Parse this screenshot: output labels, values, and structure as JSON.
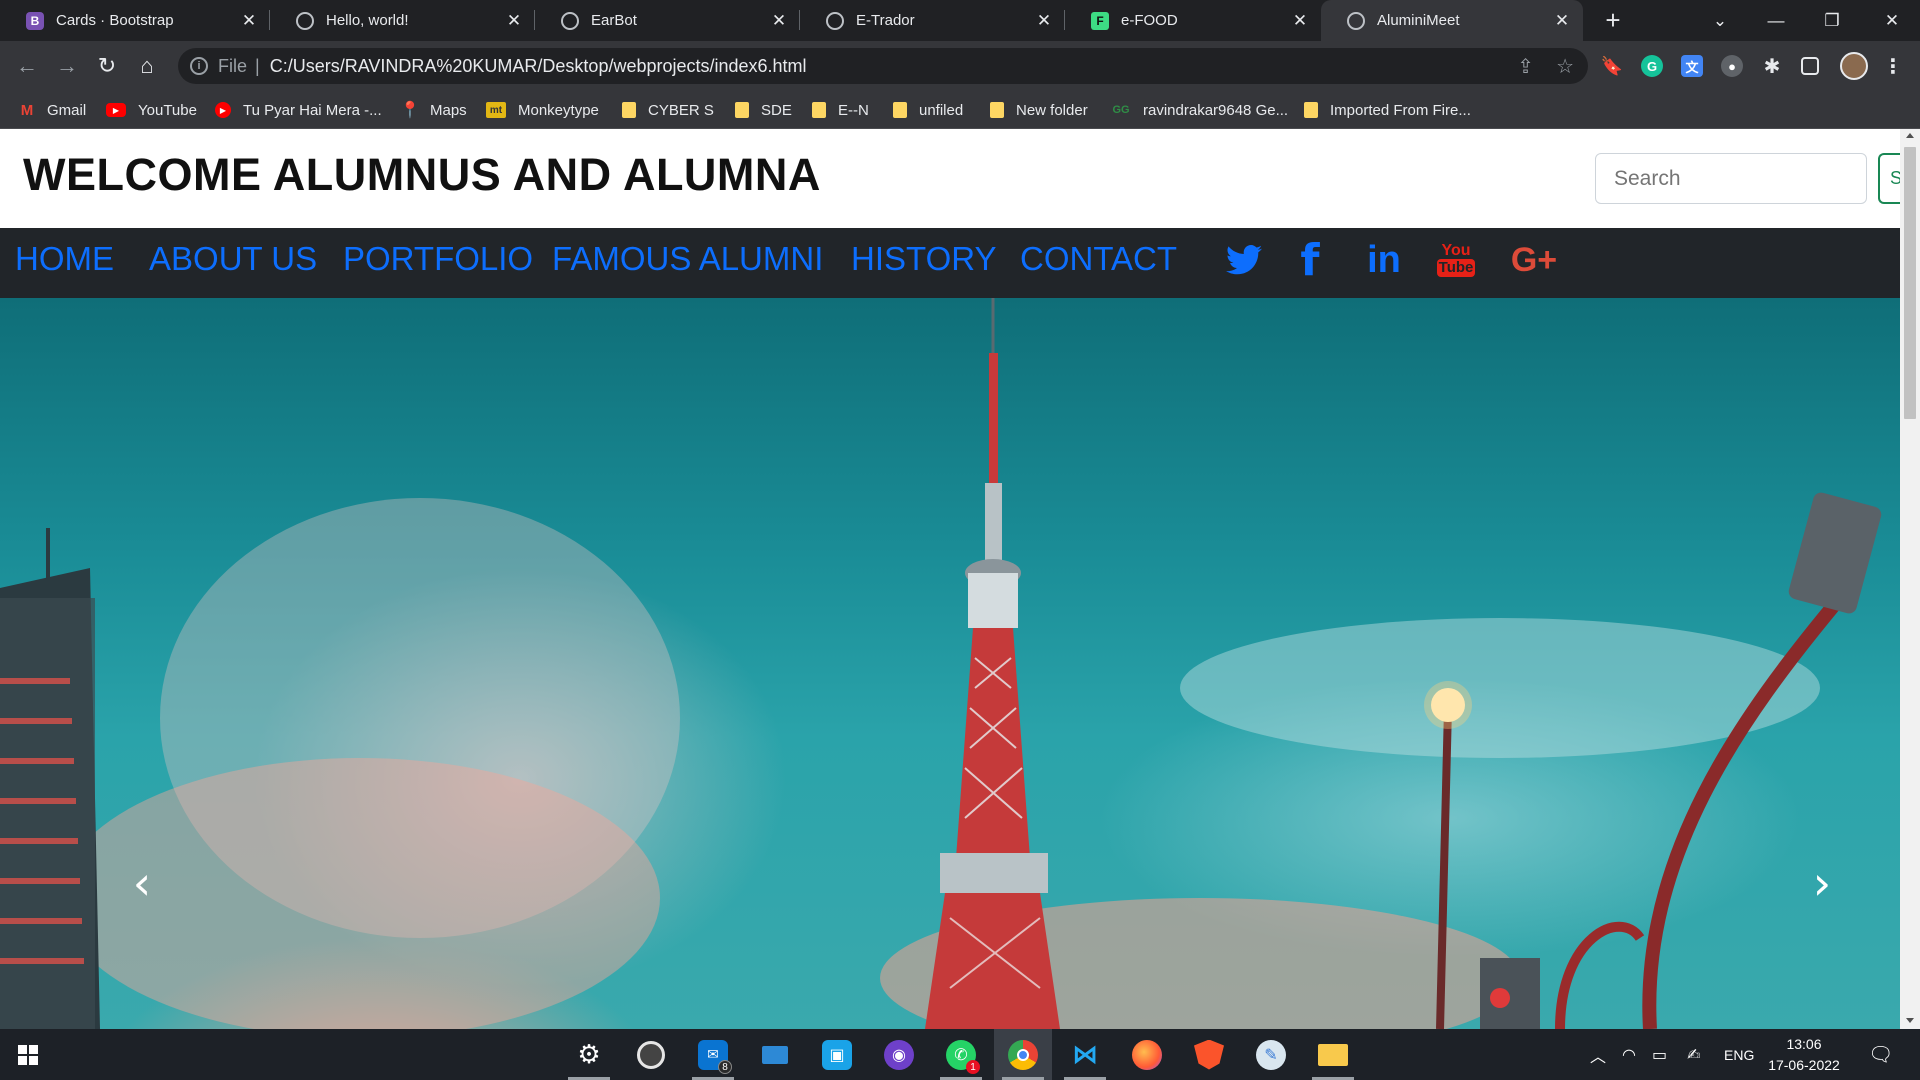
{
  "browser": {
    "tabs": [
      {
        "title": "Cards · Bootstrap",
        "favicon": "bootstrap-b-icon",
        "active": false
      },
      {
        "title": "Hello, world!",
        "favicon": "globe-icon",
        "active": false
      },
      {
        "title": "EarBot",
        "favicon": "globe-icon",
        "active": false
      },
      {
        "title": "E-Trador",
        "favicon": "globe-icon",
        "active": false
      },
      {
        "title": "e-FOOD",
        "favicon": "efood-f-icon",
        "active": false
      },
      {
        "title": "AluminiMeet",
        "favicon": "globe-icon",
        "active": true
      }
    ],
    "bootstrap_glyph": "B",
    "efood_glyph": "F",
    "address": {
      "scheme_label": "File",
      "url": "C:/Users/RAVINDRA%20KUMAR/Desktop/webprojects/index6.html"
    },
    "bookmarks": [
      {
        "label": "Gmail",
        "icon": "gmail-icon"
      },
      {
        "label": "YouTube",
        "icon": "youtube-icon"
      },
      {
        "label": "Tu Pyar Hai Mera -...",
        "icon": "youtube-music-icon"
      },
      {
        "label": "Maps",
        "icon": "maps-pin-icon"
      },
      {
        "label": "Monkeytype",
        "icon": "monkeytype-icon"
      },
      {
        "label": "CYBER S",
        "icon": "folder-icon"
      },
      {
        "label": "SDE",
        "icon": "folder-icon"
      },
      {
        "label": "E--N",
        "icon": "folder-icon"
      },
      {
        "label": "unfiled",
        "icon": "folder-icon"
      },
      {
        "label": "New folder",
        "icon": "folder-icon"
      },
      {
        "label": "ravindrakar9648 Ge...",
        "icon": "geeksforgeeks-icon"
      },
      {
        "label": "Imported From Fire...",
        "icon": "folder-icon"
      }
    ],
    "monkeytype_glyph": "mt",
    "gfg_glyph": "GG"
  },
  "page": {
    "site_title": "WELCOME ALUMNUS AND ALUMNA",
    "search": {
      "placeholder": "Search",
      "button_label": "S"
    },
    "nav": [
      "HOME",
      "ABOUT US",
      "PORTFOLIO",
      "FAMOUS ALUMNI",
      "HISTORY",
      "CONTACT"
    ],
    "social": {
      "twitter": "🐦",
      "facebook": "f",
      "linkedin": "in",
      "youtube_top": "You",
      "youtube_bottom": "Tube",
      "googleplus": "G+"
    },
    "carousel": {
      "prev": "‹",
      "next": "›"
    },
    "colors": {
      "nav_link": "#0d6efd",
      "navbar_bg": "#212529",
      "youtube_red": "#e62117",
      "gplus_red": "#dd4b39",
      "search_btn": "#198754"
    }
  },
  "taskbar": {
    "apps": [
      {
        "name": "settings",
        "icon": "gear-icon"
      },
      {
        "name": "media",
        "icon": "groove-icon"
      },
      {
        "name": "mail",
        "icon": "mail-icon",
        "badge": "8"
      },
      {
        "name": "desktop",
        "icon": "pc-icon"
      },
      {
        "name": "store",
        "icon": "store-icon"
      },
      {
        "name": "github",
        "icon": "github-icon"
      },
      {
        "name": "whatsapp",
        "icon": "whatsapp-icon",
        "badge": "1"
      },
      {
        "name": "chrome",
        "icon": "chrome-icon"
      },
      {
        "name": "vscode",
        "icon": "vscode-icon"
      },
      {
        "name": "firefox",
        "icon": "firefox-icon"
      },
      {
        "name": "brave",
        "icon": "brave-icon"
      },
      {
        "name": "paint",
        "icon": "paint-icon"
      },
      {
        "name": "explorer",
        "icon": "folder-icon"
      }
    ],
    "language": "ENG",
    "time": "13:06",
    "date": "17-06-2022"
  }
}
